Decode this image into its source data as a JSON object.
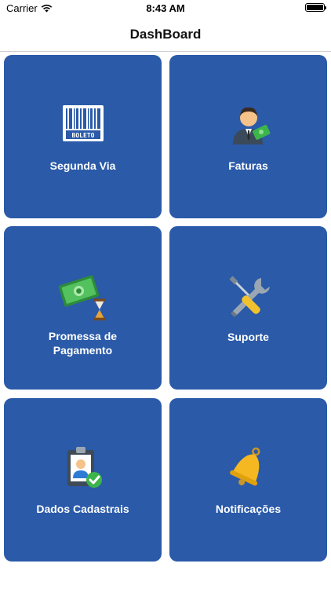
{
  "status_bar": {
    "carrier": "Carrier",
    "time": "8:43 AM",
    "icons": [
      "wifi-icon",
      "battery-icon"
    ]
  },
  "nav": {
    "title": "DashBoard"
  },
  "tiles": [
    {
      "label": "Segunda Via",
      "icon": "barcode-boleto-icon",
      "icon_text": "BOLETO"
    },
    {
      "label": "Faturas",
      "icon": "businessman-money-icon"
    },
    {
      "label": "Promessa de\nPagamento",
      "icon": "money-hourglass-icon"
    },
    {
      "label": "Suporte",
      "icon": "wrench-screwdriver-icon"
    },
    {
      "label": "Dados Cadastrais",
      "icon": "id-badge-check-icon"
    },
    {
      "label": "Notificações",
      "icon": "bell-icon"
    }
  ],
  "colors": {
    "tile_background": "#2a5aa8",
    "tile_text": "#ffffff",
    "nav_title": "#111111"
  }
}
